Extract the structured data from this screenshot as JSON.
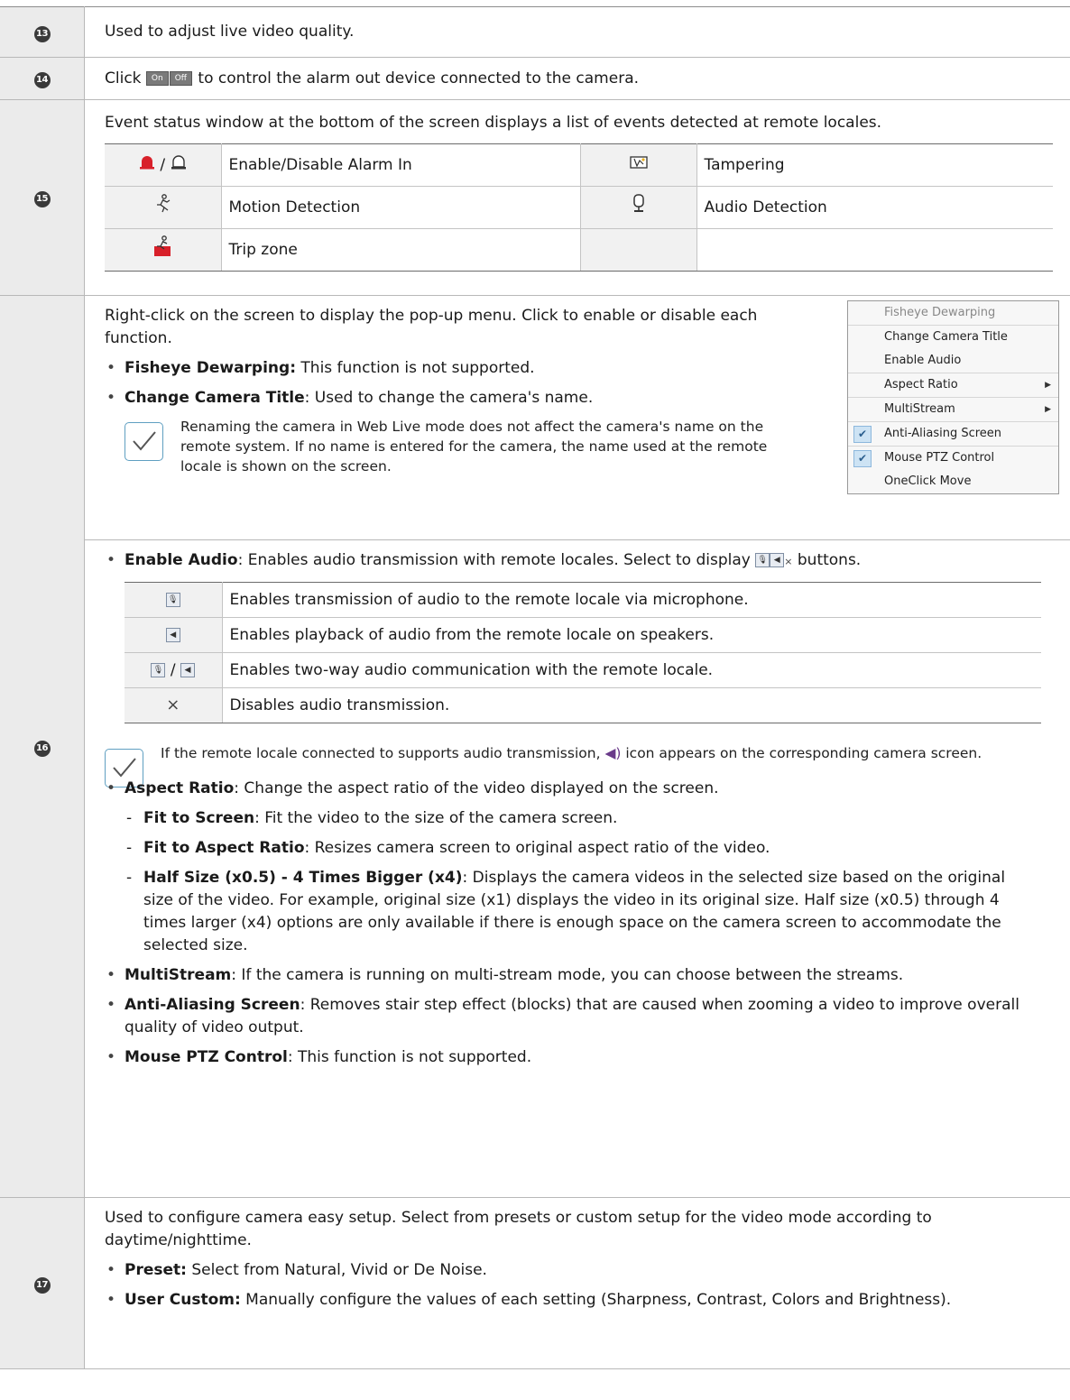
{
  "rows": {
    "r13": {
      "num": "13",
      "text": "Used to adjust live video quality."
    },
    "r14": {
      "num": "14",
      "text_before": "Click",
      "btn_on": "On",
      "btn_off": "Off",
      "text_after": "to control the alarm out device connected to the camera."
    },
    "r15": {
      "num": "15",
      "intro": "Event status window at the bottom of the screen displays a list of events detected at remote locales.",
      "events": [
        {
          "label": "Enable/Disable Alarm In",
          "icon": "alarm-in-icon",
          "sep": "/"
        },
        {
          "label": "Tampering",
          "icon": "tampering-icon"
        },
        {
          "label": "Motion Detection",
          "icon": "motion-detection-icon"
        },
        {
          "label": "Audio Detection",
          "icon": "audio-detection-icon"
        },
        {
          "label": "Trip zone",
          "icon": "trip-zone-icon"
        }
      ]
    },
    "r16": {
      "num": "16",
      "intro": "Right-click on the screen to display the pop-up menu. Click to enable or disable each function.",
      "fisheye_b": "Fisheye Dewarping:",
      "fisheye_t": " This function is not supported.",
      "title_b": "Change Camera Title",
      "title_t": ": Used to change the camera's name.",
      "note1": "Renaming the camera in Web Live mode does not affect the camera's name on the remote system. If no name is entered for the camera, the name used at the remote locale is shown on the screen.",
      "menu": {
        "fisheye": "Fisheye Dewarping",
        "change_title": "Change Camera Title",
        "enable_audio": "Enable Audio",
        "aspect": "Aspect Ratio",
        "multistream": "MultiStream",
        "anti_alias": "Anti-Aliasing Screen",
        "mouse_ptz": "Mouse PTZ Control",
        "oneclick": "OneClick Move",
        "check": "✔",
        "arrow": "▶"
      },
      "audio_b": "Enable Audio",
      "audio_t": ": Enables audio transmission with remote locales. Select to display",
      "audio_t2": "buttons.",
      "audio_rows": [
        {
          "icon": "microphone-icon",
          "text": "Enables transmission of audio to the remote locale via microphone."
        },
        {
          "icon": "speaker-icon",
          "text": "Enables playback of audio from the remote locale on speakers."
        },
        {
          "icon": "two-way-audio-icon",
          "sep": "/",
          "text": "Enables two-way audio communication with the remote locale."
        },
        {
          "icon": "close-icon",
          "glyph": "×",
          "text": "Disables audio transmission."
        }
      ],
      "note2_a": "If the remote locale connected to supports audio transmission,",
      "note2_b": "icon appears on the corresponding camera screen.",
      "aspect_b": "Aspect Ratio",
      "aspect_t": ": Change the aspect ratio of the video displayed on the screen.",
      "fit_b": "Fit to Screen",
      "fit_t": ": Fit the video to the size of the camera screen.",
      "fitar_b": "Fit to Aspect Ratio",
      "fitar_t": ": Resizes camera screen to original aspect ratio of the video.",
      "half_b": "Half Size (x0.5) - 4 Times Bigger (x4)",
      "half_t": ": Displays the camera videos in the selected size based on the original size of the video. For example, original size (x1) displays the video in its original size. Half size (x0.5) through 4 times larger (x4) options are only available if there is enough space on the camera screen to accommodate the selected size.",
      "ms_b": "MultiStream",
      "ms_t": ": If the camera is running on multi-stream mode, you can choose between the streams.",
      "aa_b": "Anti-Aliasing Screen",
      "aa_t": ": Removes stair step effect (blocks) that are caused when zooming a video to improve overall quality of video output.",
      "ptz_b": "Mouse PTZ Control",
      "ptz_t": ": This function is not supported."
    },
    "r17": {
      "num": "17",
      "intro": "Used to configure camera easy setup. Select from presets or custom setup for the video mode according to daytime/nighttime.",
      "preset_b": "Preset:",
      "preset_t": " Select from Natural, Vivid or De Noise.",
      "custom_b": "User Custom:",
      "custom_t": " Manually configure the values of each setting (Sharpness, Contrast, Colors and Brightness)."
    }
  }
}
